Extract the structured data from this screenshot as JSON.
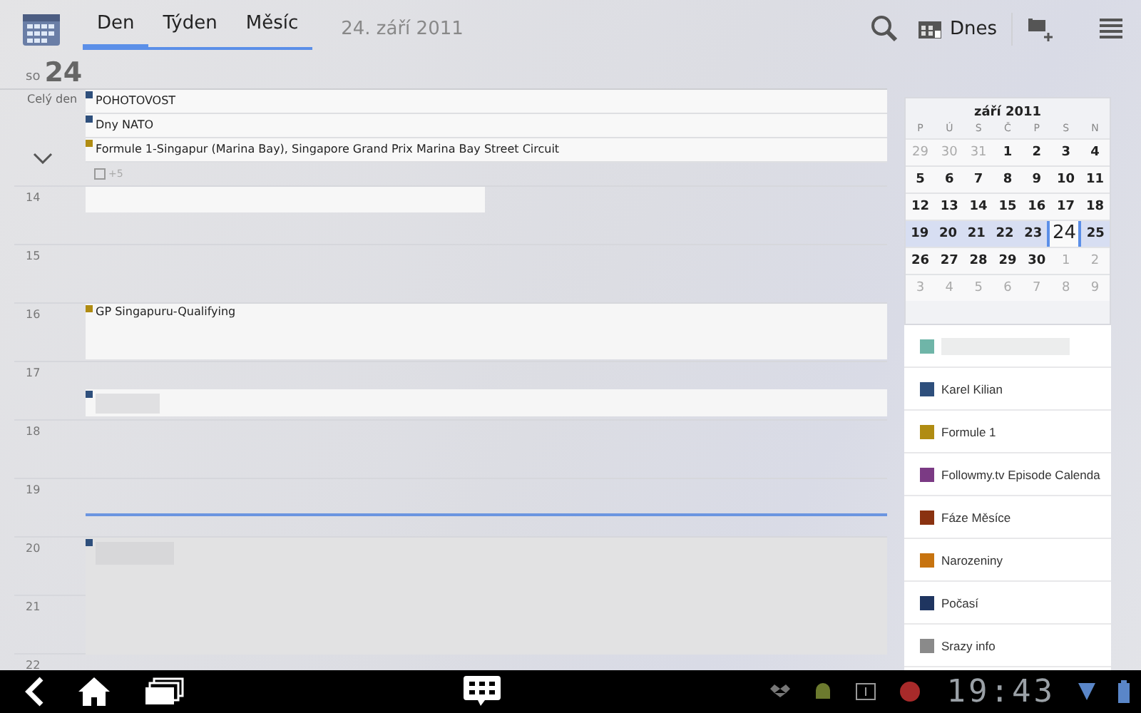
{
  "toolbar": {
    "tabs": [
      {
        "label": "Den",
        "selected": true
      },
      {
        "label": "Týden",
        "selected": false
      },
      {
        "label": "Měsíc",
        "selected": false
      }
    ],
    "date": "24. září 2011",
    "today_button": "Dnes"
  },
  "day": {
    "weekday": "so",
    "number": "24",
    "all_day_label": "Celý den",
    "all_day_events": [
      {
        "title": "POHOTOVOST",
        "color": "#2e4f7c"
      },
      {
        "title": "Dny NATO",
        "color": "#2e4f7c"
      },
      {
        "title": "Formule 1-Singapur (Marina Bay), Singapore Grand Prix Marina Bay Street Circuit",
        "color": "#b08c12"
      }
    ],
    "more_count": "+5",
    "hours": [
      {
        "label": "14",
        "events": [
          {
            "kind": "bar"
          }
        ]
      },
      {
        "label": "15"
      },
      {
        "label": "16",
        "events": [
          {
            "kind": "full",
            "title": "GP Singapuru-Qualifying",
            "color": "#b08c12"
          }
        ]
      },
      {
        "label": "17",
        "events": [
          {
            "kind": "half",
            "color": "#2e4f7c"
          }
        ]
      },
      {
        "label": "18"
      },
      {
        "label": "19",
        "now_line": true
      },
      {
        "label": "20",
        "events": [
          {
            "kind": "double",
            "color": "#2e4f7c"
          }
        ]
      },
      {
        "label": "21"
      },
      {
        "label": "22"
      }
    ]
  },
  "mini_calendar": {
    "title": "září 2011",
    "weekdays": [
      "P",
      "Ú",
      "S",
      "Č",
      "P",
      "S",
      "N"
    ],
    "weeks": [
      {
        "highlighted": false,
        "days": [
          {
            "label": "29",
            "in_month": false,
            "selected": false
          },
          {
            "label": "30",
            "in_month": false,
            "selected": false
          },
          {
            "label": "31",
            "in_month": false,
            "selected": false
          },
          {
            "label": "1",
            "in_month": true,
            "selected": false
          },
          {
            "label": "2",
            "in_month": true,
            "selected": false
          },
          {
            "label": "3",
            "in_month": true,
            "selected": false
          },
          {
            "label": "4",
            "in_month": true,
            "selected": false
          }
        ]
      },
      {
        "highlighted": false,
        "days": [
          {
            "label": "5",
            "in_month": true,
            "selected": false
          },
          {
            "label": "6",
            "in_month": true,
            "selected": false
          },
          {
            "label": "7",
            "in_month": true,
            "selected": false
          },
          {
            "label": "8",
            "in_month": true,
            "selected": false
          },
          {
            "label": "9",
            "in_month": true,
            "selected": false
          },
          {
            "label": "10",
            "in_month": true,
            "selected": false
          },
          {
            "label": "11",
            "in_month": true,
            "selected": false
          }
        ]
      },
      {
        "highlighted": false,
        "days": [
          {
            "label": "12",
            "in_month": true,
            "selected": false
          },
          {
            "label": "13",
            "in_month": true,
            "selected": false
          },
          {
            "label": "14",
            "in_month": true,
            "selected": false
          },
          {
            "label": "15",
            "in_month": true,
            "selected": false
          },
          {
            "label": "16",
            "in_month": true,
            "selected": false
          },
          {
            "label": "17",
            "in_month": true,
            "selected": false
          },
          {
            "label": "18",
            "in_month": true,
            "selected": false
          }
        ]
      },
      {
        "highlighted": true,
        "days": [
          {
            "label": "19",
            "in_month": true,
            "selected": false
          },
          {
            "label": "20",
            "in_month": true,
            "selected": false
          },
          {
            "label": "21",
            "in_month": true,
            "selected": false
          },
          {
            "label": "22",
            "in_month": true,
            "selected": false
          },
          {
            "label": "23",
            "in_month": true,
            "selected": false
          },
          {
            "label": "24",
            "in_month": true,
            "selected": true
          },
          {
            "label": "25",
            "in_month": true,
            "selected": false
          }
        ]
      },
      {
        "highlighted": false,
        "days": [
          {
            "label": "26",
            "in_month": true,
            "selected": false
          },
          {
            "label": "27",
            "in_month": true,
            "selected": false
          },
          {
            "label": "28",
            "in_month": true,
            "selected": false
          },
          {
            "label": "29",
            "in_month": true,
            "selected": false
          },
          {
            "label": "30",
            "in_month": true,
            "selected": false
          },
          {
            "label": "1",
            "in_month": false,
            "selected": false
          },
          {
            "label": "2",
            "in_month": false,
            "selected": false
          }
        ]
      },
      {
        "highlighted": false,
        "days": [
          {
            "label": "3",
            "in_month": false,
            "selected": false
          },
          {
            "label": "4",
            "in_month": false,
            "selected": false
          },
          {
            "label": "5",
            "in_month": false,
            "selected": false
          },
          {
            "label": "6",
            "in_month": false,
            "selected": false
          },
          {
            "label": "7",
            "in_month": false,
            "selected": false
          },
          {
            "label": "8",
            "in_month": false,
            "selected": false
          },
          {
            "label": "9",
            "in_month": false,
            "selected": false
          }
        ]
      }
    ]
  },
  "calendars": [
    {
      "color": "#6fb5a8"
    },
    {
      "name": "Karel Kilian",
      "color": "#2e4f7c"
    },
    {
      "name": "Formule 1",
      "color": "#b08c12"
    },
    {
      "name": "Followmy.tv Episode Calenda",
      "color": "#7b3a84"
    },
    {
      "name": "Fáze Měsíce",
      "color": "#8a3210"
    },
    {
      "name": "Narozeniny",
      "color": "#c7730f"
    },
    {
      "name": "Počasí",
      "color": "#1f3560"
    },
    {
      "name": "Srazy info",
      "color": "#8a8a8a"
    }
  ],
  "status_bar": {
    "time": "19:43"
  }
}
